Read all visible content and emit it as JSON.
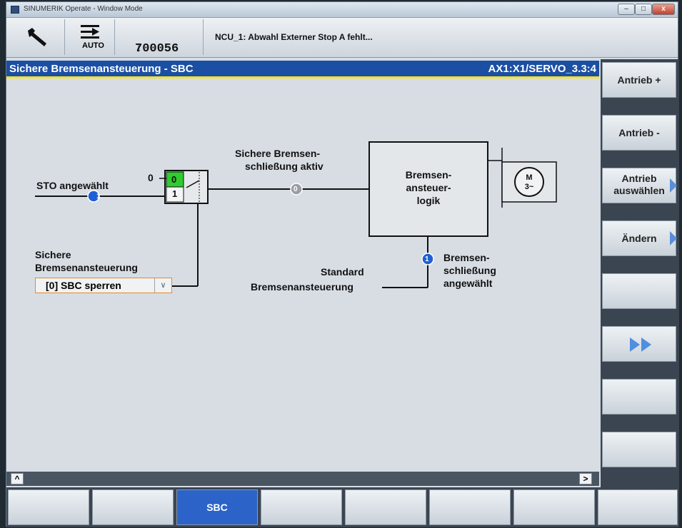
{
  "window": {
    "title": "SINUMERIK Operate - Window Mode",
    "buttons": {
      "minimize": "–",
      "maximize": "□",
      "close": "x"
    }
  },
  "header": {
    "wrench_icon": "wrench-icon",
    "mode_label": "AUTO",
    "program": "700056",
    "program_marker": "↓",
    "alarm_text": "NCU_1: Abwahl Externer Stop A fehlt..."
  },
  "page": {
    "title": "Sichere Bremsenansteuerung - SBC",
    "axis": "AX1:X1/SERVO_3.3:4"
  },
  "diagram": {
    "sto_label": "STO angewählt",
    "sto_value": "1",
    "switch_zero_label": "0",
    "switch_top": "0",
    "switch_bottom": "1",
    "sbc_active_line1": "Sichere Bremsen-",
    "sbc_active_line2": "schließung aktiv",
    "sbc_active_value": "0",
    "logic_line1": "Bremsen-",
    "logic_line2": "ansteuer-",
    "logic_line3": "logik",
    "motor_line1": "M",
    "motor_line2": "3~",
    "safe_ctrl_line1": "Sichere",
    "safe_ctrl_line2": "Bremsenansteuerung",
    "sbc_select_value": "[0] SBC sperren",
    "std_line1": "Standard",
    "std_line2": "Bremsenansteuerung",
    "brake_sel_value": "1",
    "brake_sel_line1": "Bremsen-",
    "brake_sel_line2": "schließung",
    "brake_sel_line3": "angewählt"
  },
  "scroll": {
    "left": "^",
    "right": ">"
  },
  "vertical_softkeys": [
    {
      "label1": "Antrieb +",
      "label2": ""
    },
    {
      "label1": "Antrieb -",
      "label2": ""
    },
    {
      "label1": "Antrieb",
      "label2": "auswählen"
    },
    {
      "label1": "Ändern",
      "label2": ""
    },
    {
      "label1": "",
      "label2": ""
    },
    {
      "label1": "",
      "label2": ""
    },
    {
      "label1": "",
      "label2": ""
    },
    {
      "label1": "",
      "label2": ""
    }
  ],
  "horizontal_softkeys": [
    "",
    "",
    "SBC",
    "",
    "",
    "",
    "",
    ""
  ],
  "colors": {
    "accent_blue": "#1b4fa3",
    "highlight_yellow": "#f6e12a",
    "switch_green": "#2ecc2e",
    "status_blue": "#1f5fd6",
    "status_gray": "#9a9fa6"
  }
}
